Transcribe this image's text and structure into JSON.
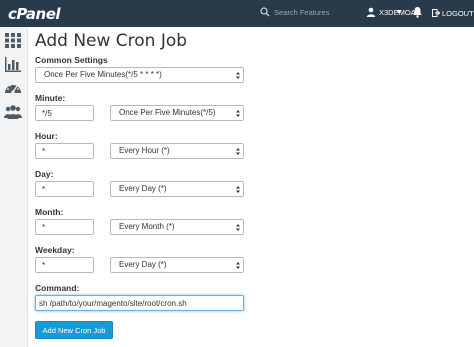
{
  "header": {
    "logo": "cPanel",
    "search_placeholder": "Search Features",
    "username": "X3DEMOA",
    "logout_label": "LOGOUT",
    "bg_color": "#293a4a"
  },
  "sidebar": {
    "items": [
      {
        "icon": "grid-icon"
      },
      {
        "icon": "bar-chart-icon"
      },
      {
        "icon": "dashboard-icon"
      },
      {
        "icon": "users-icon"
      }
    ]
  },
  "page": {
    "title": "Add New Cron Job"
  },
  "form": {
    "common_settings_label": "Common Settings",
    "common_settings_value": "Once Per Five Minutes(*/5 * * * *)",
    "minute_label": "Minute:",
    "minute_value": "*/5",
    "minute_select": "Once Per Five Minutes(*/5)",
    "hour_label": "Hour:",
    "hour_value": "*",
    "hour_select": "Every Hour (*)",
    "day_label": "Day:",
    "day_value": "*",
    "day_select": "Every Day (*)",
    "month_label": "Month:",
    "month_value": "*",
    "month_select": "Every Month (*)",
    "weekday_label": "Weekday:",
    "weekday_value": "*",
    "weekday_select": "Every Day (*)",
    "command_label": "Command:",
    "command_value": "sh /path/to/your/magento/site/root/cron.sh",
    "submit_label": "Add New Cron Job",
    "submit_color": "#179bd7"
  }
}
